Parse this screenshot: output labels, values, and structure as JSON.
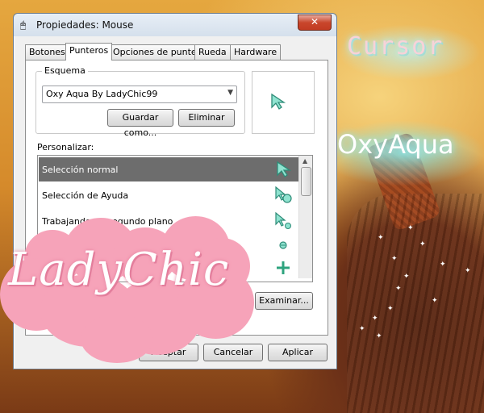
{
  "window": {
    "title": "Propiedades: Mouse",
    "close_label": "✕"
  },
  "tabs": [
    {
      "label": "Botones"
    },
    {
      "label": "Punteros",
      "active": true
    },
    {
      "label": "Opciones de puntero"
    },
    {
      "label": "Rueda"
    },
    {
      "label": "Hardware"
    }
  ],
  "scheme": {
    "group_label": "Esquema",
    "selected_value": "Oxy Aqua By LadyChic99",
    "save_label": "Guardar como...",
    "delete_label": "Eliminar"
  },
  "customize": {
    "label": "Personalizar:",
    "items": [
      {
        "label": "Selección normal",
        "selected": true,
        "cursor_icon": "arrow-cursor"
      },
      {
        "label": "Selección de Ayuda",
        "cursor_icon": "help-cursor"
      },
      {
        "label": "Trabajando en segundo plano",
        "cursor_icon": "working-cursor"
      },
      {
        "label": "",
        "cursor_icon": "busy-cursor"
      },
      {
        "label": "",
        "cursor_icon": "crosshair-cursor"
      }
    ],
    "browse_label": "Examinar..."
  },
  "footer": {
    "ok_label": "Aceptar",
    "cancel_label": "Cancelar",
    "apply_label": "Aplicar"
  },
  "decorations": {
    "cursor_text": "Cursor",
    "oxy_text": "OxyAqua",
    "lady_text": "LadyChic",
    "colors": {
      "aqua": "#7fd6c8",
      "pink": "#f6a3b9",
      "selected_row": "#6d6d6d"
    }
  }
}
